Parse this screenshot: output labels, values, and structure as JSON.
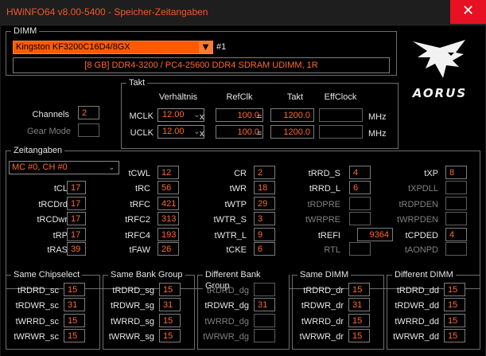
{
  "window": {
    "title": "HWiNFO64 v8.00-5400 - Speicher-Zeitangaben",
    "close_glyph": "✕"
  },
  "dimm": {
    "group_label": "DIMM",
    "module": "Kingston KF3200C16D4/8GX",
    "slot": "#1",
    "summary": "[8 GB] DDR4-3200 / PC4-25600 DDR4 SDRAM UDIMM, 1R"
  },
  "logo_text": "AORUS",
  "channels": {
    "label": "Channels",
    "value": "2",
    "gear_label": "Gear Mode",
    "gear_value": ""
  },
  "takt": {
    "group_label": "Takt",
    "headers": {
      "ratio": "Verhältnis",
      "refclk": "RefClk",
      "takt": "Takt",
      "effclock": "EffClock"
    },
    "rows": [
      {
        "label": "MCLK",
        "ratio": "12.00",
        "times": "x",
        "refclk": "100.0",
        "equals": "=",
        "takt": "1200.0",
        "eff": "",
        "unit": "MHz"
      },
      {
        "label": "UCLK",
        "ratio": "12.00",
        "times": "x",
        "refclk": "100.0",
        "equals": "=",
        "takt": "1200.0",
        "eff": "",
        "unit": "MHz"
      }
    ]
  },
  "zeitangaben": {
    "group_label": "Zeitangaben",
    "channel_select": "MC #0, CH #0",
    "col1": [
      {
        "label": "tCL",
        "value": "17"
      },
      {
        "label": "tRCDrd",
        "value": "17"
      },
      {
        "label": "tRCDwr",
        "value": "17"
      },
      {
        "label": "tRP",
        "value": "17"
      },
      {
        "label": "tRAS",
        "value": "39"
      }
    ],
    "col2": [
      {
        "label": "tCWL",
        "value": "12"
      },
      {
        "label": "tRC",
        "value": "56"
      },
      {
        "label": "tRFC",
        "value": "421"
      },
      {
        "label": "tRFC2",
        "value": "313"
      },
      {
        "label": "tRFC4",
        "value": "193"
      },
      {
        "label": "tFAW",
        "value": "26"
      }
    ],
    "col3": [
      {
        "label": "CR",
        "value": "2"
      },
      {
        "label": "tWR",
        "value": "18"
      },
      {
        "label": "tWTP",
        "value": "29"
      },
      {
        "label": "tWTR_S",
        "value": "3"
      },
      {
        "label": "tWTR_L",
        "value": "9"
      },
      {
        "label": "tCKE",
        "value": "6"
      }
    ],
    "col4": [
      {
        "label": "tRRD_S",
        "value": "4"
      },
      {
        "label": "tRRD_L",
        "value": "6"
      },
      {
        "label": "tRDPRE",
        "value": ""
      },
      {
        "label": "tWRPRE",
        "value": ""
      },
      {
        "label": "tREFI",
        "value": "9364"
      },
      {
        "label": "RTL",
        "value": ""
      }
    ],
    "col5": [
      {
        "label": "tXP",
        "value": "8"
      },
      {
        "label": "tXPDLL",
        "value": ""
      },
      {
        "label": "tRDPDEN",
        "value": ""
      },
      {
        "label": "tWRPDEN",
        "value": ""
      },
      {
        "label": "tCPDED",
        "value": "4"
      },
      {
        "label": "tAONPD",
        "value": ""
      }
    ]
  },
  "turnaround": [
    {
      "title": "Same Chipselect",
      "rows": [
        {
          "label": "tRDRD_sc",
          "value": "15"
        },
        {
          "label": "tRDWR_sc",
          "value": "31"
        },
        {
          "label": "tWRRD_sc",
          "value": "15"
        },
        {
          "label": "tWRWR_sc",
          "value": "15"
        }
      ]
    },
    {
      "title": "Same Bank Group",
      "rows": [
        {
          "label": "tRDRD_sg",
          "value": "15"
        },
        {
          "label": "tRDWR_sg",
          "value": "31"
        },
        {
          "label": "tWRRD_sg",
          "value": "15"
        },
        {
          "label": "tWRWR_sg",
          "value": "15"
        }
      ]
    },
    {
      "title": "Different Bank Group",
      "rows": [
        {
          "label": "tRDRD_dg",
          "value": ""
        },
        {
          "label": "tRDWR_dg",
          "value": "31"
        },
        {
          "label": "tWRRD_dg",
          "value": ""
        },
        {
          "label": "tWRWR_dg",
          "value": ""
        }
      ]
    },
    {
      "title": "Same DIMM",
      "rows": [
        {
          "label": "tRDRD_dr",
          "value": "15"
        },
        {
          "label": "tRDWR_dr",
          "value": "31"
        },
        {
          "label": "tWRRD_dr",
          "value": "15"
        },
        {
          "label": "tWRWR_dr",
          "value": "15"
        }
      ]
    },
    {
      "title": "Different DIMM",
      "rows": [
        {
          "label": "tRDRD_dd",
          "value": "15"
        },
        {
          "label": "tRDWR_dd",
          "value": "15"
        },
        {
          "label": "tWRRD_dd",
          "value": "15"
        },
        {
          "label": "tWRWR_dd",
          "value": "15"
        }
      ]
    }
  ],
  "colors": {
    "accent": "#ff6a2a",
    "title": "#f0582a",
    "dropdown_bg": "#ff5a00",
    "close_bg": "#e81123"
  }
}
